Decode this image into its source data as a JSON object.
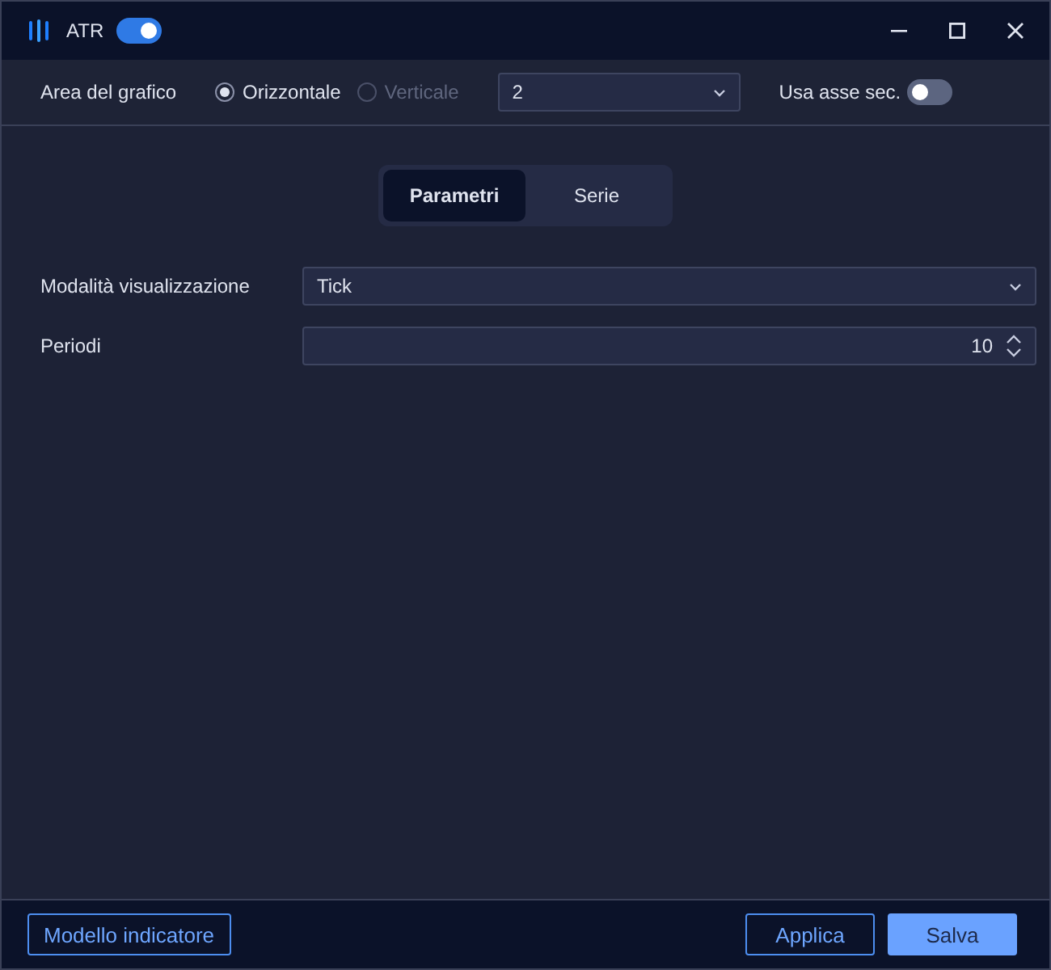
{
  "window": {
    "title": "ATR",
    "enabled": true
  },
  "chart_area": {
    "label": "Area del grafico",
    "options": [
      {
        "label": "Orizzontale",
        "selected": true,
        "disabled": false
      },
      {
        "label": "Verticale",
        "selected": false,
        "disabled": true
      }
    ],
    "pane": {
      "value": "2"
    },
    "secondary_axis": {
      "label": "Usa asse sec.",
      "on": false
    }
  },
  "tabs": [
    {
      "label": "Parametri",
      "selected": true
    },
    {
      "label": "Serie",
      "selected": false
    }
  ],
  "fields": [
    {
      "kind": "select",
      "label": "Modalità visualizzazione",
      "value": "Tick"
    },
    {
      "kind": "number",
      "label": "Periodi",
      "value": "10"
    }
  ],
  "footer": {
    "left": [
      {
        "label": "Modello indicatore",
        "kind": "outline"
      }
    ],
    "right": [
      {
        "label": "Applica",
        "kind": "outline"
      },
      {
        "label": "Salva",
        "kind": "primary"
      }
    ]
  }
}
